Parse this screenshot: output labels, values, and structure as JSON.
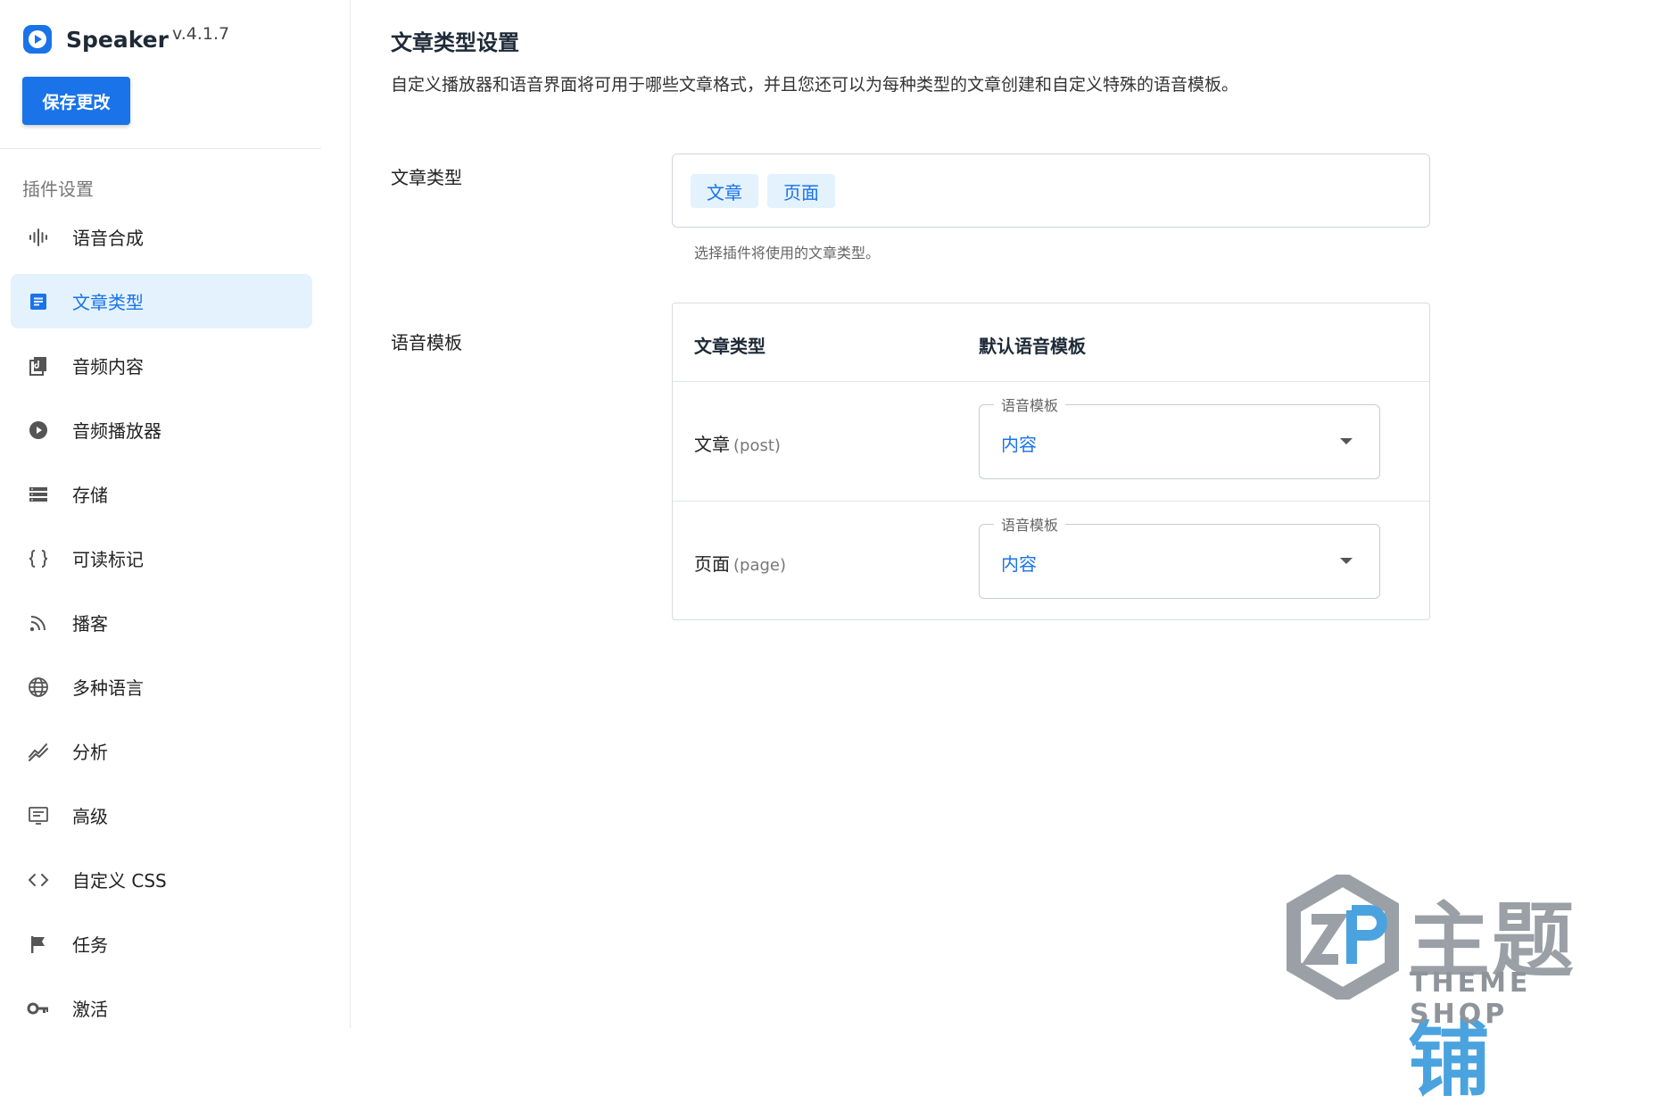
{
  "app": {
    "name": "Speaker",
    "version": "v.4.1.7",
    "save_label": "保存更改"
  },
  "sidebar": {
    "section_label": "插件设置",
    "items": [
      {
        "label": "语音合成",
        "icon": "waveform-icon"
      },
      {
        "label": "文章类型",
        "icon": "document-icon",
        "active": true
      },
      {
        "label": "音频内容",
        "icon": "audio-content-icon"
      },
      {
        "label": "音频播放器",
        "icon": "play-circle-icon"
      },
      {
        "label": "存储",
        "icon": "storage-icon"
      },
      {
        "label": "可读标记",
        "icon": "braces-icon"
      },
      {
        "label": "播客",
        "icon": "rss-icon"
      },
      {
        "label": "多种语言",
        "icon": "globe-icon"
      },
      {
        "label": "分析",
        "icon": "analytics-icon"
      },
      {
        "label": "高级",
        "icon": "advanced-icon"
      },
      {
        "label": "自定义 CSS",
        "icon": "code-icon"
      },
      {
        "label": "任务",
        "icon": "flag-icon"
      },
      {
        "label": "激活",
        "icon": "key-icon"
      }
    ]
  },
  "main": {
    "title": "文章类型设置",
    "description": "自定义播放器和语音界面将可用于哪些文章格式，并且您还可以为每种类型的文章创建和自定义特殊的语音模板。",
    "post_types": {
      "label": "文章类型",
      "chips": [
        "文章",
        "页面"
      ],
      "helper": "选择插件将使用的文章类型。"
    },
    "templates": {
      "label": "语音模板",
      "col_type": "文章类型",
      "col_template": "默认语音模板",
      "rows": [
        {
          "name": "文章",
          "slug": "(post)",
          "select_legend": "语音模板",
          "select_value": "内容"
        },
        {
          "name": "页面",
          "slug": "(page)",
          "select_legend": "语音模板",
          "select_value": "内容"
        }
      ]
    }
  },
  "watermark": {
    "zh_gray": "主题",
    "zh_blue": "铺",
    "en": "THEME SHOP"
  },
  "colors": {
    "accent": "#1a73e8",
    "active_bg": "#e3f2fd"
  }
}
